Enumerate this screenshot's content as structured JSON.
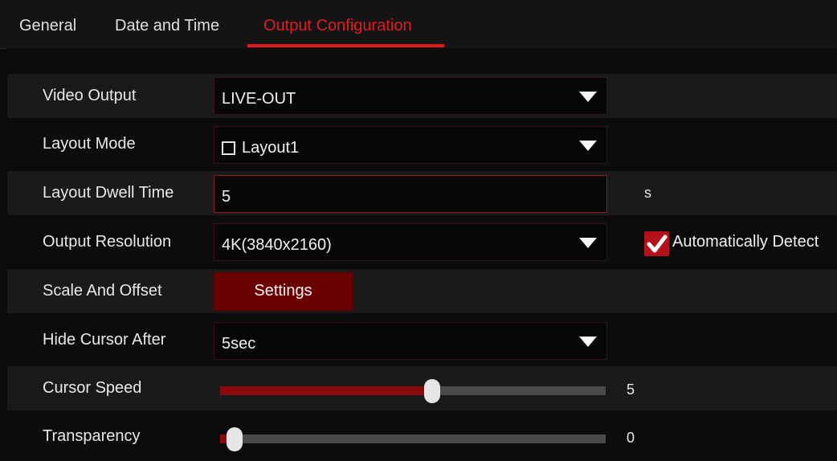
{
  "tabs": [
    {
      "label": "General"
    },
    {
      "label": "Date and Time"
    },
    {
      "label": "Output Configuration",
      "active": true
    }
  ],
  "accent_color": "#e21b23",
  "rows": {
    "video_output": {
      "label": "Video Output",
      "value": "LIVE-OUT"
    },
    "layout_mode": {
      "label": "Layout Mode",
      "value": "Layout1",
      "checked": false
    },
    "layout_dwell_time": {
      "label": "Layout Dwell Time",
      "value": "5",
      "unit": "s"
    },
    "output_resolution": {
      "label": "Output Resolution",
      "value": "4K(3840x2160)",
      "auto_detect_label": "Automatically Detect",
      "auto_detect_checked": true
    },
    "scale_and_offset": {
      "label": "Scale And Offset",
      "button_label": "Settings"
    },
    "hide_cursor_after": {
      "label": "Hide Cursor After",
      "value": "5sec"
    },
    "cursor_speed": {
      "label": "Cursor Speed",
      "value": "5",
      "level_fraction": 0.55
    },
    "transparency": {
      "label": "Transparency",
      "value": "0",
      "level_fraction": 0.0
    }
  },
  "icons": {
    "dropdown": "caret-down-icon",
    "checkbox_empty": "checkbox-empty-icon",
    "checkbox_checked": "checkmark-icon"
  }
}
